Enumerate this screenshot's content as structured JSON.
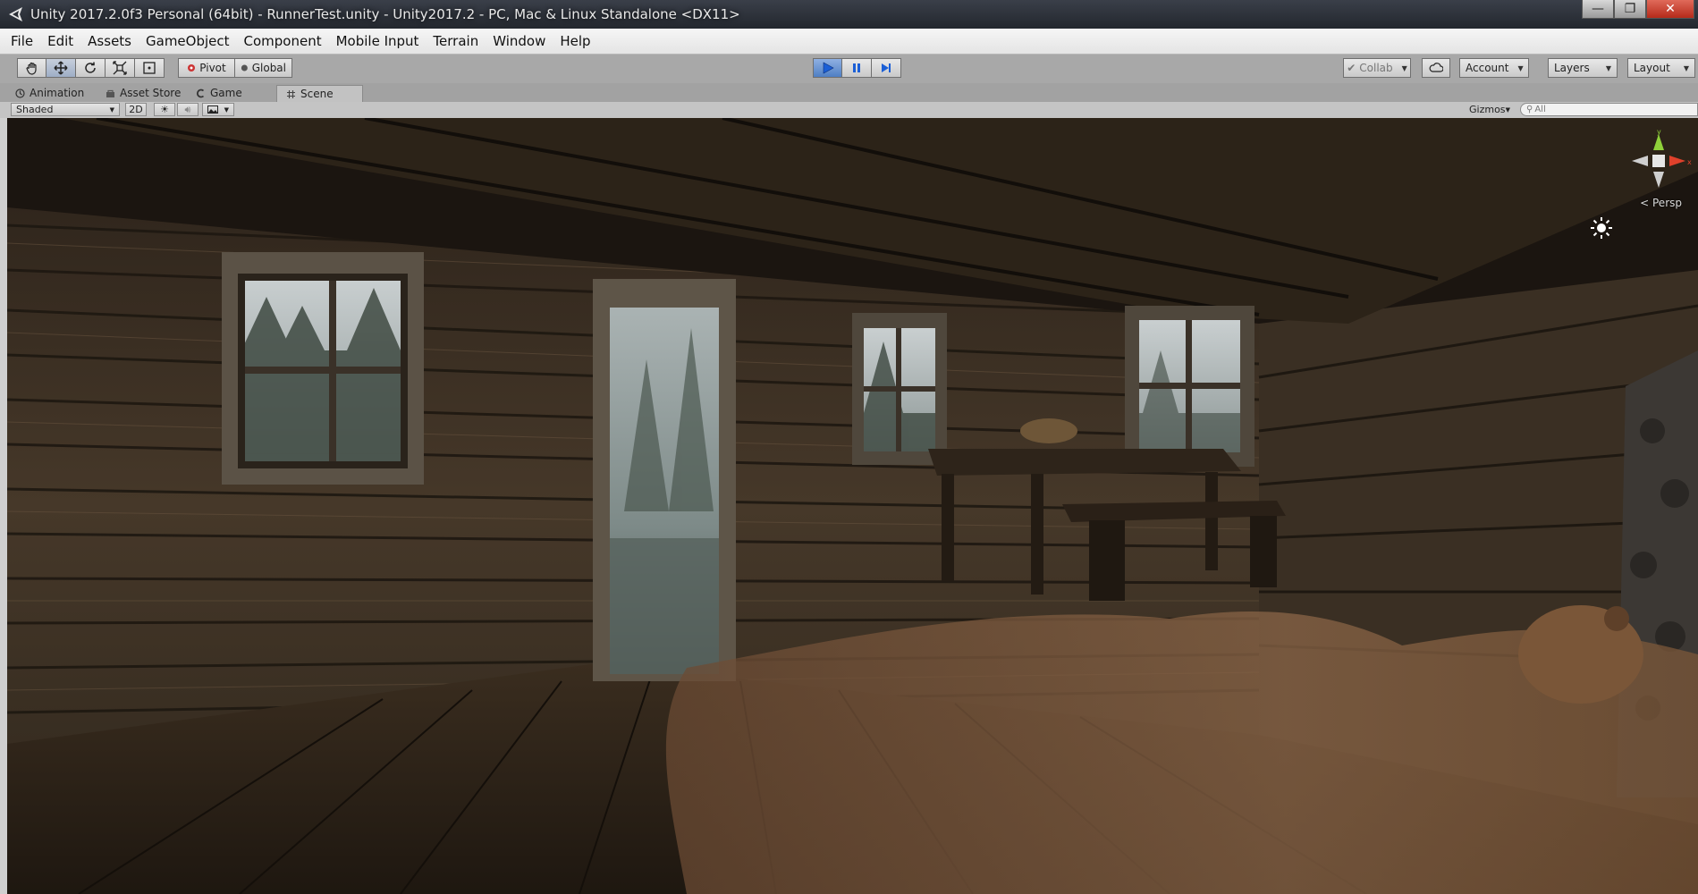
{
  "window": {
    "title": "Unity 2017.2.0f3 Personal (64bit) - RunnerTest.unity - Unity2017.2 - PC, Mac & Linux Standalone <DX11>",
    "minimize_icon": "minimize-icon",
    "maximize_icon": "maximize-icon",
    "close_icon": "close-icon"
  },
  "menu": {
    "items": [
      "File",
      "Edit",
      "Assets",
      "GameObject",
      "Component",
      "Mobile Input",
      "Terrain",
      "Window",
      "Help"
    ]
  },
  "toolbar": {
    "transform_tools": [
      "hand-tool-icon",
      "move-tool-icon",
      "rotate-tool-icon",
      "scale-tool-icon",
      "rect-tool-icon"
    ],
    "pivot_label": "Pivot",
    "global_label": "Global",
    "play_state": "playing",
    "collab_label": "Collab",
    "account_label": "Account",
    "layers_label": "Layers",
    "layout_label": "Layout"
  },
  "tabs": {
    "items": [
      {
        "label": "Animation",
        "icon": "animation-icon",
        "active": false
      },
      {
        "label": "Asset Store",
        "icon": "asset-store-icon",
        "active": false
      },
      {
        "label": "Game",
        "icon": "game-icon",
        "active": false
      },
      {
        "label": "Scene",
        "icon": "scene-icon",
        "active": true
      }
    ]
  },
  "scene_toolbar": {
    "shading_mode": "Shaded",
    "mode_2d": "2D",
    "gizmos_label": "Gizmos",
    "search_placeholder": "All"
  },
  "scene_view": {
    "projection_label": "Persp",
    "colors": {
      "wall_log": "#4a3c2c",
      "floor": "#2f2419",
      "fog": "#8e9a99",
      "gizmo_y": "#8fd13a",
      "gizmo_x": "#e0412b"
    }
  }
}
